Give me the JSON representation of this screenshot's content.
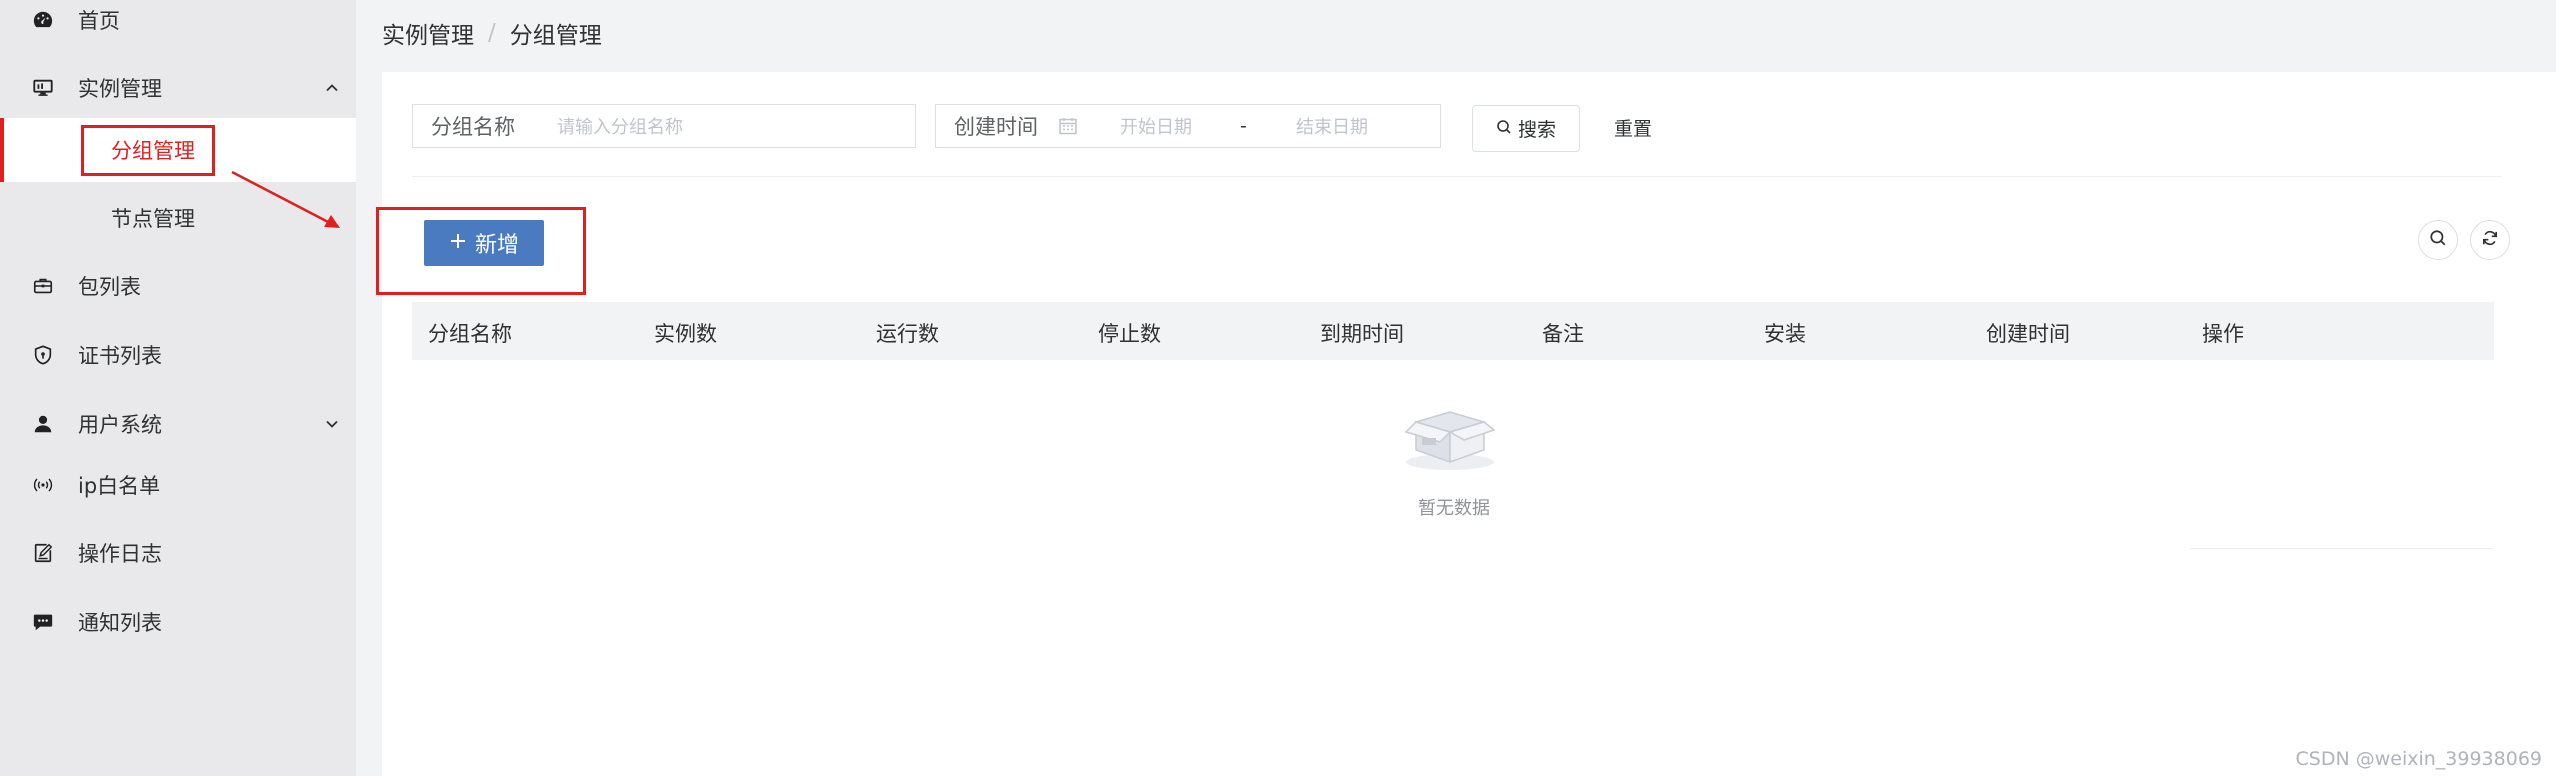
{
  "sidebar": {
    "items": [
      {
        "label": "首页",
        "icon": "dashboard-icon"
      },
      {
        "label": "实例管理",
        "icon": "monitor-icon",
        "expanded": true,
        "children": [
          {
            "label": "分组管理",
            "active": true
          },
          {
            "label": "节点管理"
          }
        ]
      },
      {
        "label": "包列表",
        "icon": "briefcase-icon"
      },
      {
        "label": "证书列表",
        "icon": "shield-icon"
      },
      {
        "label": "用户系统",
        "icon": "user-icon",
        "expanded": false
      },
      {
        "label": "ip白名单",
        "icon": "broadcast-icon"
      },
      {
        "label": "操作日志",
        "icon": "edit-log-icon"
      },
      {
        "label": "通知列表",
        "icon": "message-icon"
      }
    ]
  },
  "breadcrumb": {
    "items": [
      "实例管理",
      "分组管理"
    ],
    "separator": "/"
  },
  "filters": {
    "group_name_label": "分组名称",
    "group_name_placeholder": "请输入分组名称",
    "created_time_label": "创建时间",
    "start_placeholder": "开始日期",
    "range_sep": "-",
    "end_placeholder": "结束日期",
    "search_label": "搜索",
    "reset_label": "重置"
  },
  "toolbar": {
    "add_label": "新增"
  },
  "table": {
    "columns": [
      "分组名称",
      "实例数",
      "运行数",
      "停止数",
      "到期时间",
      "备注",
      "安装",
      "创建时间",
      "操作"
    ],
    "rows": [],
    "empty_text": "暂无数据"
  },
  "watermark": "CSDN @weixin_39938069",
  "colors": {
    "accent": "#4a7bc0",
    "active": "#e0201f",
    "sidebar_bg": "#e9e9eb"
  }
}
